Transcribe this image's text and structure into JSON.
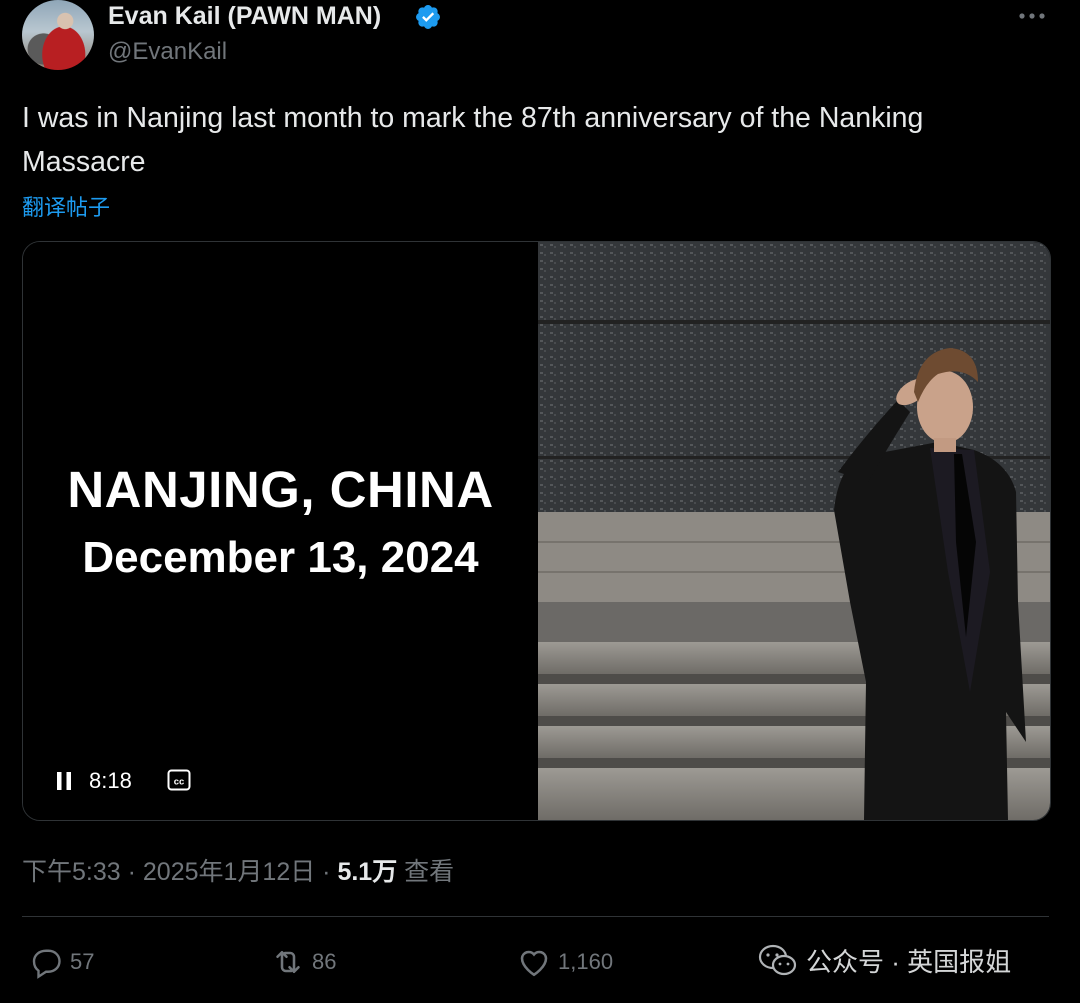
{
  "author": {
    "name": "Evan Kail (PAWN MAN)",
    "handle": "@EvanKail",
    "verified_color": "#1d9bf0"
  },
  "tweet": {
    "text": "I was in Nanjing last month to mark the 87th anniversary of the Nanking Massacre",
    "translate_label": "翻译帖子"
  },
  "video": {
    "title_line1": "NANJING, CHINA",
    "title_line2": "December 13, 2024",
    "time": "8:18",
    "pause_icon": "pause-icon",
    "cc_icon": "captions-icon"
  },
  "meta": {
    "time": "下午5:33",
    "sep1": " · ",
    "date": "2025年1月12日",
    "sep2": " · ",
    "views_count": "5.1万",
    "views_label": " 查看"
  },
  "actions": {
    "replies": "57",
    "retweets": "86",
    "likes": "1,160"
  },
  "watermark": {
    "text": "公众号 · 英国报姐"
  },
  "colors": {
    "background": "#000000",
    "text": "#e7e9ea",
    "muted": "#71767b",
    "link": "#1d9bf0"
  }
}
